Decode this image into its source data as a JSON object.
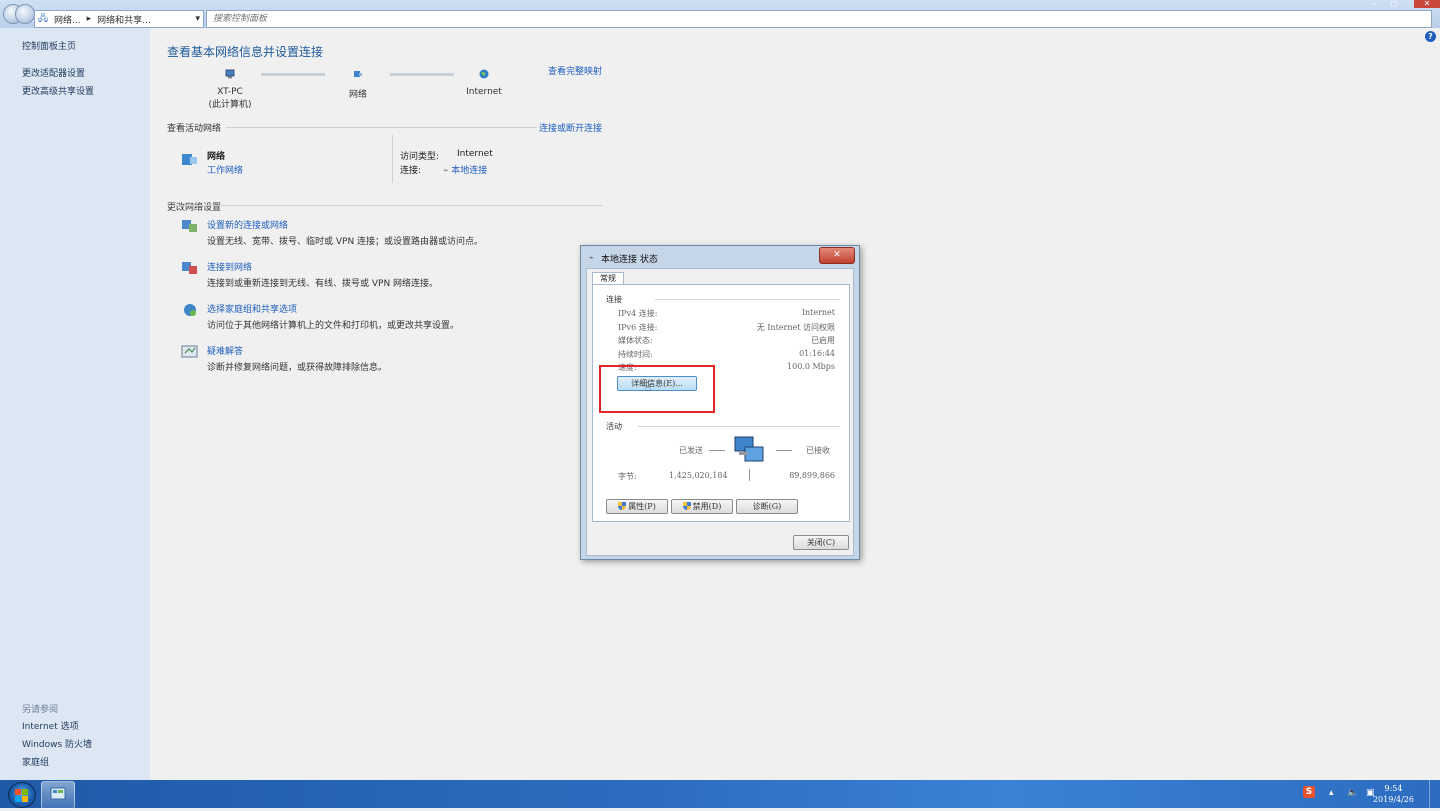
{
  "address": {
    "crumbs": [
      "网络...",
      "网络和共享..."
    ],
    "search_placeholder": "搜索控制面板"
  },
  "left_nav": {
    "items": [
      "控制面板主页",
      "更改适配器设置",
      "更改高级共享设置"
    ],
    "see_also_label": "另请参阅",
    "see_also": [
      "Internet 选项",
      "Windows 防火墙",
      "家庭组"
    ]
  },
  "main": {
    "title": "查看基本网络信息并设置连接",
    "view_full_map": "查看完整映射",
    "map": {
      "pc_name": "XT-PC",
      "pc_sub": "(此计算机)",
      "network": "网络",
      "internet": "Internet"
    },
    "active_networks": {
      "header": "查看活动网络",
      "connect_link": "连接或断开连接",
      "network_name": "网络",
      "network_type": "工作网络",
      "access_label": "访问类型:",
      "access_value": "Internet",
      "conn_label": "连接:",
      "conn_value": "本地连接"
    },
    "change_settings": {
      "header": "更改网络设置",
      "tasks": [
        {
          "link": "设置新的连接或网络",
          "desc": "设置无线、宽带、拨号、临时或 VPN 连接；或设置路由器或访问点。"
        },
        {
          "link": "连接到网络",
          "desc": "连接到或重新连接到无线、有线、拨号或 VPN 网络连接。"
        },
        {
          "link": "选择家庭组和共享选项",
          "desc": "访问位于其他网络计算机上的文件和打印机，或更改共享设置。"
        },
        {
          "link": "疑难解答",
          "desc": "诊断并修复网络问题，或获得故障排除信息。"
        }
      ]
    }
  },
  "dialog": {
    "title": "本地连接 状态",
    "close_glyph": "✕",
    "tab": "常规",
    "connection_header": "连接",
    "rows": [
      {
        "label": "IPv4 连接:",
        "value": "Internet"
      },
      {
        "label": "IPv6 连接:",
        "value": "无 Internet 访问权限"
      },
      {
        "label": "媒体状态:",
        "value": "已启用"
      },
      {
        "label": "持续时间:",
        "value": "01:16:44"
      },
      {
        "label": "速度:",
        "value": "100.0 Mbps"
      }
    ],
    "details_button": "详细信息(E)...",
    "activity_header": "活动",
    "sent_label": "已发送",
    "received_label": "已接收",
    "bytes_label": "字节:",
    "bytes_sent": "1,425,020,184",
    "bytes_received": "89,899,866",
    "properties_button": "属性(P)",
    "disable_button": "禁用(D)",
    "diagnose_button": "诊断(G)",
    "close_button": "关闭(C)"
  },
  "taskbar": {
    "time": "9:54",
    "date": "2019/4/26",
    "ime_label": "S"
  },
  "colors": {
    "link": "#1f5fbf",
    "highlight_box": "#e0262a",
    "taskbar": "#2c6cc0"
  }
}
